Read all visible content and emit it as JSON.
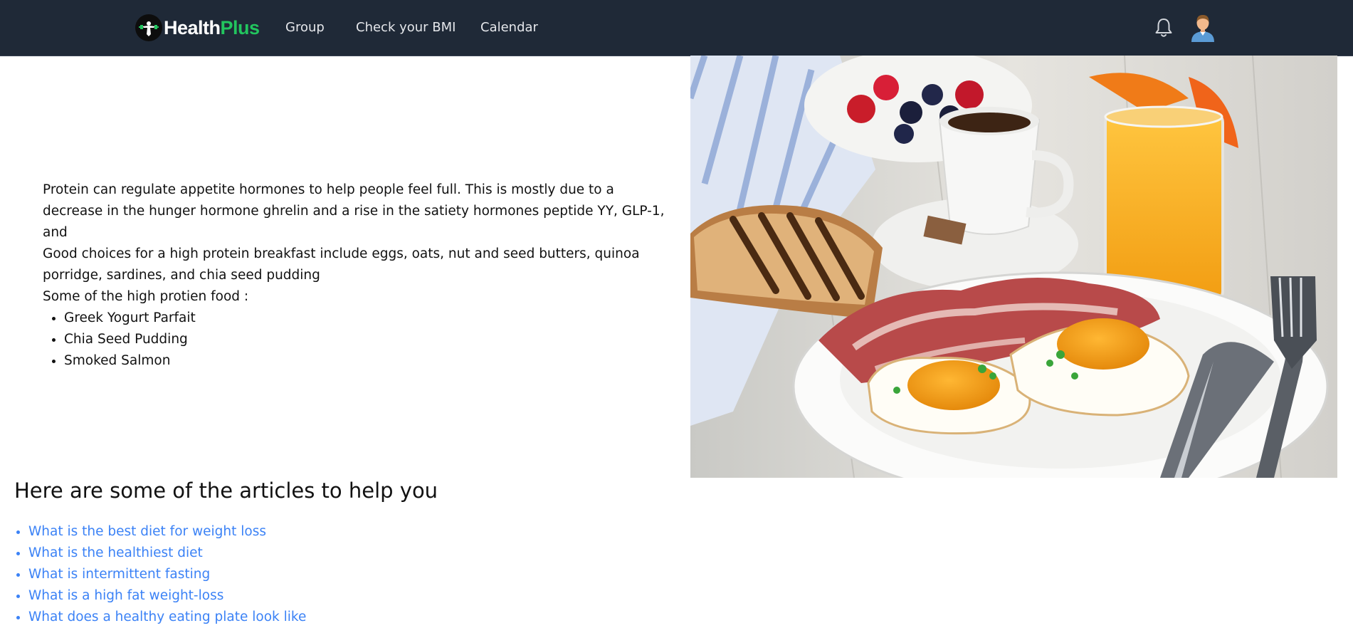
{
  "nav": {
    "brand_health": "Health",
    "brand_plus": "Plus",
    "links": [
      {
        "label": "Group"
      },
      {
        "label": "Check your BMI"
      },
      {
        "label": "Calendar"
      }
    ],
    "icons": [
      "notification-bell-icon",
      "user-avatar-icon"
    ],
    "colors": {
      "navbar_bg": "#1f2937",
      "brand_accent": "#22c55e",
      "link": "#3b82f6"
    }
  },
  "intro": {
    "paragraph_1": "Protein can regulate appetite hormones to help people feel full. This is mostly due to a decrease in the hunger hormone ghrelin and a rise in the satiety hormones peptide YY, GLP-1, and",
    "paragraph_2": "Good choices for a high protein breakfast include eggs, oats, nut and seed butters, quinoa porridge, sardines, and chia seed pudding",
    "list_heading": "Some of the high protien food :",
    "foods": [
      "Greek Yogurt Parfait",
      "Chia Seed Pudding",
      "Smoked Salmon"
    ]
  },
  "articles": {
    "heading": "Here are some of the articles to help you",
    "links": [
      "What is the best diet for weight loss",
      "What is the healthiest diet",
      "What is intermittent fasting",
      "What is a high fat weight-loss",
      "What does a healthy eating plate look like"
    ]
  }
}
